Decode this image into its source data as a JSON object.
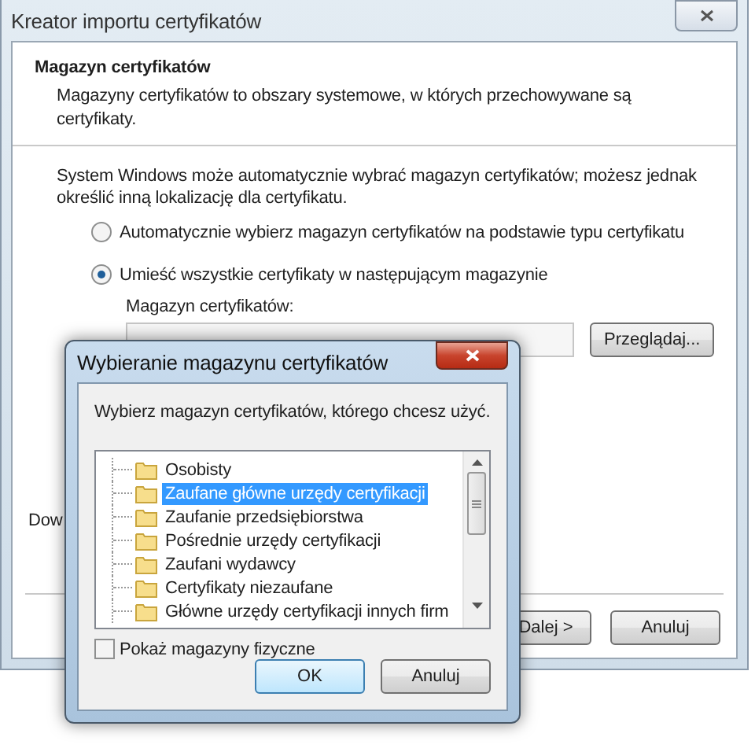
{
  "window": {
    "title": "Kreator importu certyfikatów"
  },
  "header": {
    "title": "Magazyn certyfikatów",
    "description": "Magazyny certyfikatów to obszary systemowe, w których przechowywane są certyfikaty."
  },
  "intro": "System Windows może automatycznie wybrać magazyn certyfikatów; możesz jednak określić inną lokalizację dla certyfikatu.",
  "options": [
    {
      "label": "Automatycznie wybierz magazyn certyfikatów na podstawie typu certyfikatu",
      "selected": false
    },
    {
      "label": "Umieść wszystkie certyfikaty w następującym magazynie",
      "selected": true
    }
  ],
  "store_field": {
    "label": "Magazyn certyfikatów:",
    "button": "Przeglądaj..."
  },
  "hidden_text": "Dow",
  "buttons": [
    "Dalej >",
    "Anuluj"
  ],
  "dialog": {
    "title": "Wybieranie magazynu certyfikatów",
    "prompt": "Wybierz magazyn certyfikatów, którego chcesz użyć.",
    "stores": [
      {
        "label": "Osobisty",
        "selected": false
      },
      {
        "label": "Zaufane główne urzędy certyfikacji",
        "selected": true
      },
      {
        "label": "Zaufanie przedsiębiorstwa",
        "selected": false
      },
      {
        "label": "Pośrednie urzędy certyfikacji",
        "selected": false
      },
      {
        "label": "Zaufani wydawcy",
        "selected": false
      },
      {
        "label": "Certyfikaty niezaufane",
        "selected": false
      },
      {
        "label": "Główne urzędy certyfikacji innych firm",
        "selected": false
      }
    ],
    "show_physical": {
      "label": "Pokaż magazyny fizyczne",
      "checked": false
    },
    "buttons": [
      "OK",
      "Anuluj"
    ]
  }
}
